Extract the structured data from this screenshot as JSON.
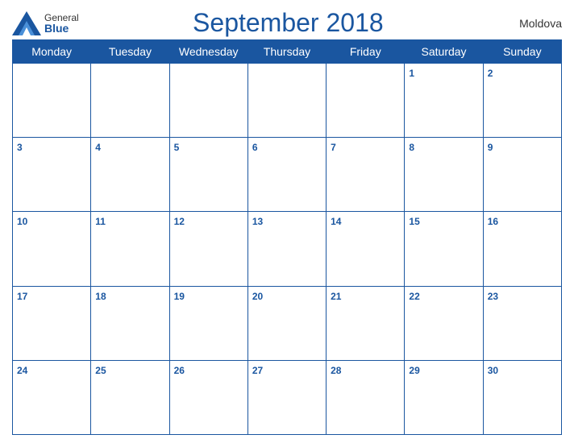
{
  "header": {
    "title": "September 2018",
    "country": "Moldova",
    "logo": {
      "general": "General",
      "blue": "Blue"
    }
  },
  "weekdays": [
    "Monday",
    "Tuesday",
    "Wednesday",
    "Thursday",
    "Friday",
    "Saturday",
    "Sunday"
  ],
  "weeks": [
    [
      null,
      null,
      null,
      null,
      null,
      1,
      2
    ],
    [
      3,
      4,
      5,
      6,
      7,
      8,
      9
    ],
    [
      10,
      11,
      12,
      13,
      14,
      15,
      16
    ],
    [
      17,
      18,
      19,
      20,
      21,
      22,
      23
    ],
    [
      24,
      25,
      26,
      27,
      28,
      29,
      30
    ]
  ]
}
